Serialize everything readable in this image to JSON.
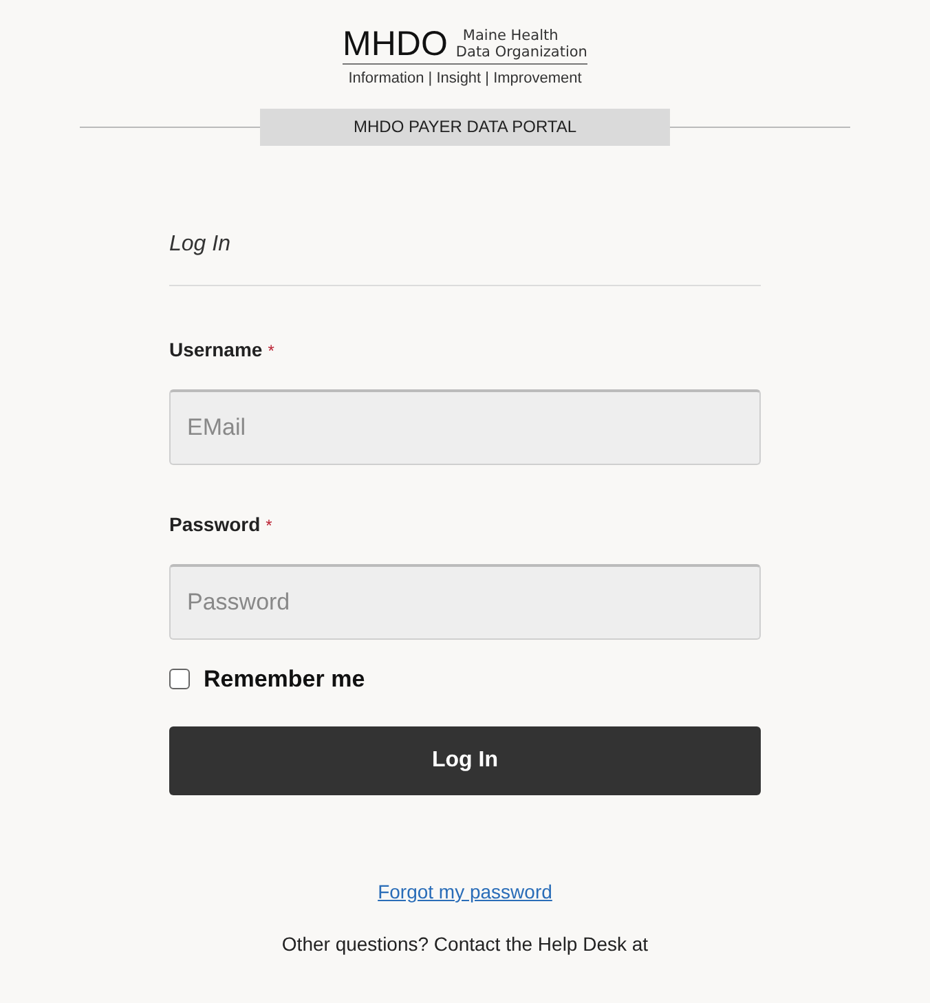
{
  "logo": {
    "mark": "MHDO",
    "name_line_1": "Maine Health",
    "name_line_2": "Data Organization",
    "tagline": "Information | Insight | Improvement"
  },
  "banner": "MHDO PAYER DATA PORTAL",
  "form": {
    "title": "Log In",
    "fields": [
      {
        "label": "Username",
        "required_mark": "*",
        "placeholder": "EMail"
      },
      {
        "label": "Password",
        "required_mark": "*",
        "placeholder": "Password"
      }
    ],
    "remember": {
      "label": "Remember me",
      "checked": false
    },
    "submit": "Log In"
  },
  "forgot_link": "Forgot my password",
  "help_text": "Other questions? Contact the Help Desk at"
}
